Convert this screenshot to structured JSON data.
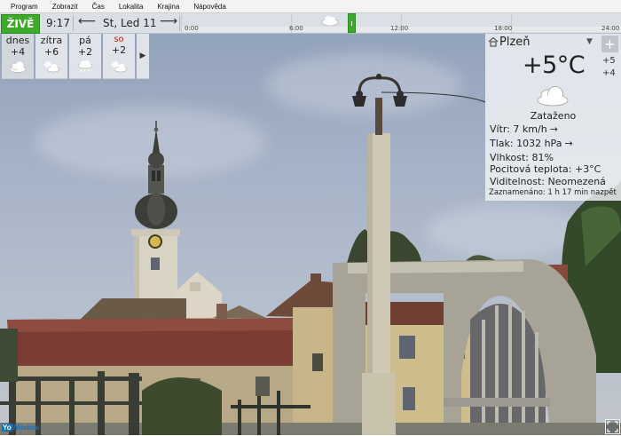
{
  "menu": [
    "Program",
    "Zobrazit",
    "Čas",
    "Lokalita",
    "Krajina",
    "Nápověda"
  ],
  "topbar": {
    "live_label": "ŽIVĚ",
    "time": "9:17",
    "prev_arrow": "⟵",
    "date": "St, Led 11",
    "next_arrow": "⟶",
    "timeline_ticks": [
      "0:00",
      "6:00",
      "12:00",
      "18:00",
      "24:00"
    ]
  },
  "forecast": [
    {
      "day": "dnes",
      "temp": "+4",
      "icon": "cloud-icon",
      "weekend": false
    },
    {
      "day": "zítra",
      "temp": "+6",
      "icon": "sun-cloud-icon",
      "weekend": false
    },
    {
      "day": "pá",
      "temp": "+2",
      "icon": "rain-cloud-icon",
      "weekend": false
    },
    {
      "day": "so",
      "temp": "+2",
      "icon": "sun-cloud-icon",
      "weekend": true
    }
  ],
  "forecast_more": "▶",
  "panel": {
    "location": "Plzeň",
    "dropdown": "▼",
    "add": "+",
    "temperature": "+5°C",
    "high": "+5",
    "low": "+4",
    "condition": "Zataženo",
    "wind": "Vítr:  7 km/h",
    "wind_arrow": "→",
    "pressure": "Tlak:  1032 hPa",
    "pressure_arrow": "→",
    "humidity": "Vlhkost:  81%",
    "feels_like": "Pocitová teplota:  +3°C",
    "visibility": "Viditelnost:  Neomezená",
    "recorded": "Zaznamenáno:  1 h 17 min nazpět"
  },
  "logo": {
    "yo": "Yo",
    "rest": "Window"
  },
  "colors": {
    "live": "#3eaa2a",
    "weekend": "#c8201b",
    "logo": "#1b6fb5"
  }
}
